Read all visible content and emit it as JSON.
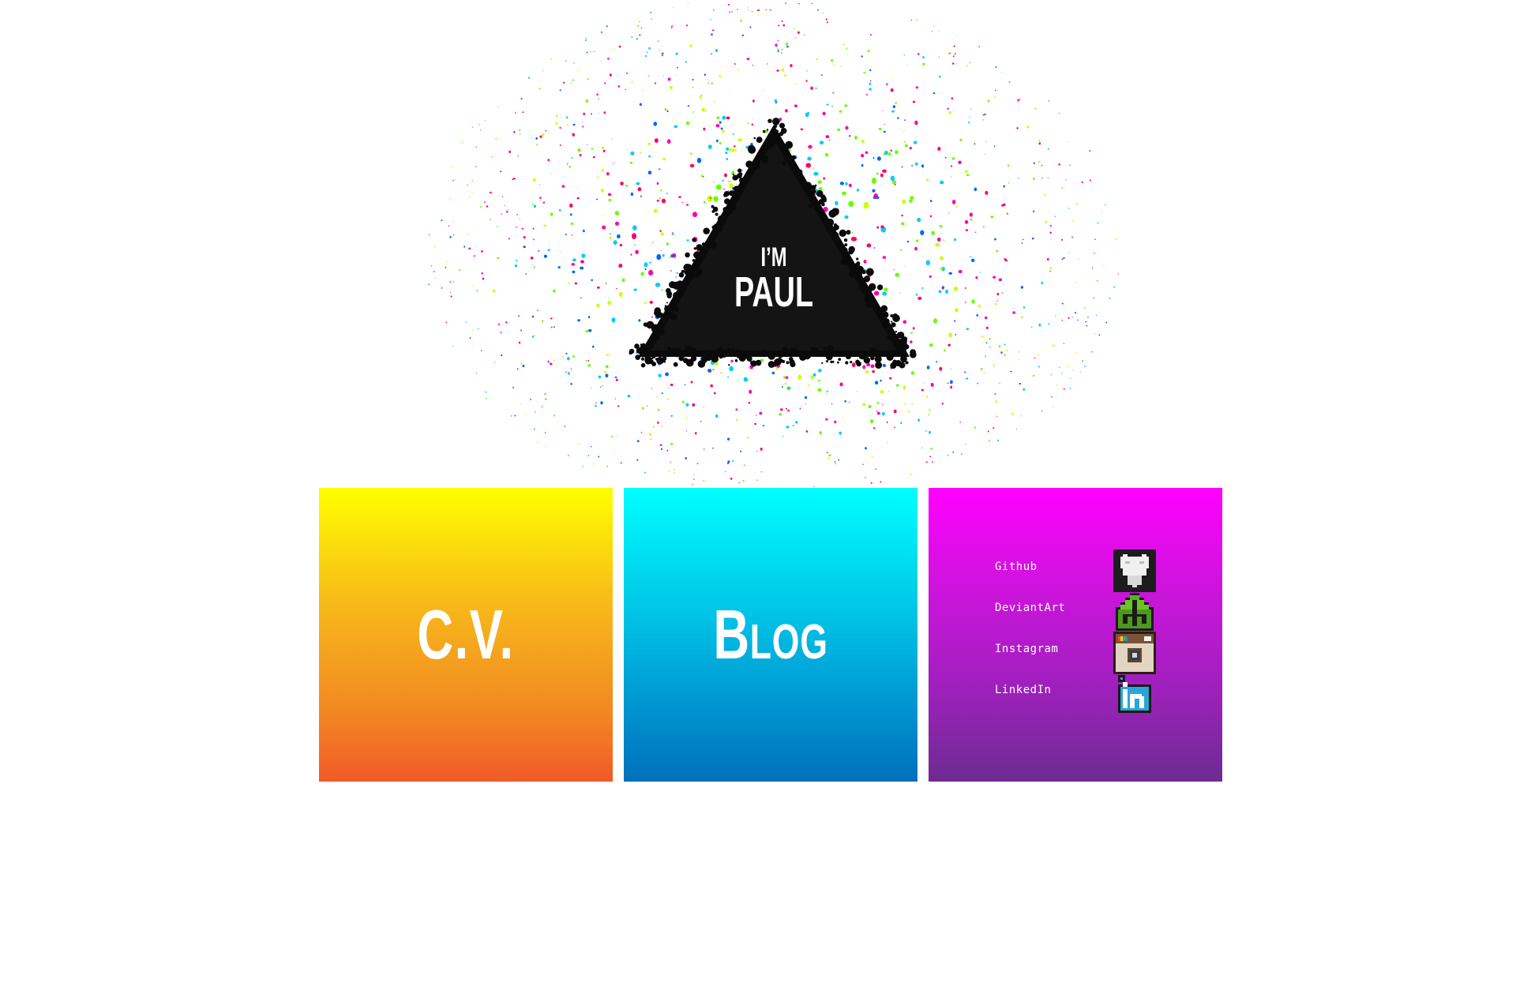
{
  "hero": {
    "greeting": "I’M",
    "name": "PAUL",
    "splash_colors": [
      "#ff00aa",
      "#0066ff",
      "#66ff00",
      "#00ccff",
      "#ff0066",
      "#ccff00"
    ]
  },
  "tiles": {
    "cv": {
      "label": "C.V.",
      "colors": [
        "#ffff00",
        "#f15a29"
      ]
    },
    "blog": {
      "label": "Blog",
      "colors": [
        "#00ffff",
        "#0070bb"
      ]
    },
    "social": {
      "colors": [
        "#ff00ff",
        "#6d2c91"
      ],
      "links": [
        {
          "label": "Github",
          "icon": "github-icon"
        },
        {
          "label": "DeviantArt",
          "icon": "deviantart-icon"
        },
        {
          "label": "Instagram",
          "icon": "instagram-icon"
        },
        {
          "label": "LinkedIn",
          "icon": "linkedin-icon"
        }
      ]
    }
  }
}
